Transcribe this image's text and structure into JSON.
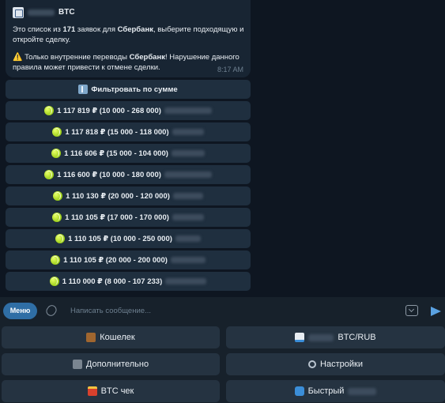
{
  "message": {
    "bot_name": "BTC",
    "intro_pre": "Это список из ",
    "count": "171",
    "intro_mid": " заявок для ",
    "bank": "Сбербанк",
    "intro_post": ", выберите подходящую и откройте сделку.",
    "warning_icon": "⚠️",
    "warning_pre": " Только внутренние переводы ",
    "warning_bank": "Сбербанк",
    "warning_post": "! Нарушение данного правила может привести к отмене сделки.",
    "time": "8:17 AM"
  },
  "inline_buttons": [
    {
      "label": "Фильтровать по сумме",
      "icon": "filter-icon"
    },
    {
      "label": "1 117 819 ₽ (10 000 - 268 000)",
      "icon": "tennis-ball-icon"
    },
    {
      "label": "1 117 818 ₽ (15 000 - 118 000)",
      "icon": "tennis-ball-icon"
    },
    {
      "label": "1 116 606 ₽ (15 000 - 104 000)",
      "icon": "tennis-ball-icon"
    },
    {
      "label": "1 116 600 ₽ (10 000 - 180 000)",
      "icon": "tennis-ball-icon"
    },
    {
      "label": "1 110 130 ₽ (20 000 - 120 000)",
      "icon": "tennis-ball-icon"
    },
    {
      "label": "1 110 105 ₽ (17 000 - 170 000)",
      "icon": "tennis-ball-icon"
    },
    {
      "label": "1 110 105 ₽ (10 000 - 250 000)",
      "icon": "tennis-ball-icon"
    },
    {
      "label": "1 110 105 ₽ (20 000 - 200 000)",
      "icon": "tennis-ball-icon"
    },
    {
      "label": "1 110 000 ₽ (8 000 - 107 233)",
      "icon": "tennis-ball-icon"
    }
  ],
  "input": {
    "menu_label": "Меню",
    "placeholder": "Написать сообщение..."
  },
  "keyboard": {
    "wallet": "Кошелек",
    "rate": "BTC/RUB",
    "more": "Дополнительно",
    "settings": "Настройки",
    "btc_check": "BTC чек",
    "fast": "Быстрый"
  },
  "colors": {
    "background": "#0e1621",
    "bubble": "#182533",
    "button": "#1f2f3f",
    "accent": "#2f6ea5"
  }
}
